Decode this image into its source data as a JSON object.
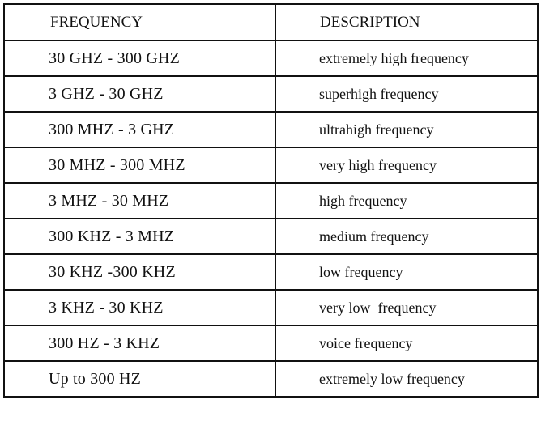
{
  "table": {
    "headers": {
      "frequency": "FREQUENCY",
      "description": "DESCRIPTION"
    },
    "rows": [
      {
        "frequency": "30 GHZ - 300 GHZ",
        "description": "extremely high frequency"
      },
      {
        "frequency": "3 GHZ - 30 GHZ",
        "description": "superhigh frequency"
      },
      {
        "frequency": "300 MHZ - 3 GHZ",
        "description": "ultrahigh frequency"
      },
      {
        "frequency": "30 MHZ - 300 MHZ",
        "description": "very high frequency"
      },
      {
        "frequency": "3 MHZ - 30 MHZ",
        "description": "high frequency"
      },
      {
        "frequency": "300 KHZ - 3 MHZ",
        "description": "medium frequency"
      },
      {
        "frequency": "30 KHZ -300 KHZ",
        "description": "low frequency"
      },
      {
        "frequency": "3 KHZ - 30 KHZ",
        "description": "very low  frequency"
      },
      {
        "frequency": "300 HZ - 3 KHZ",
        "description": "voice frequency"
      },
      {
        "frequency": "Up to 300 HZ",
        "description": "extremely low frequency"
      }
    ]
  }
}
